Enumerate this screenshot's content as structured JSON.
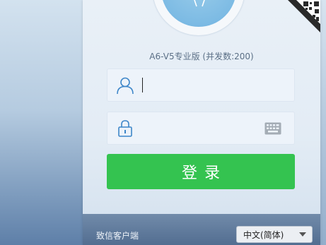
{
  "window": {
    "version_label": "A6-V5专业版 (并发数:200)"
  },
  "login_form": {
    "username": {
      "value": "",
      "placeholder": "",
      "icon": "user-icon"
    },
    "password": {
      "value": "",
      "placeholder": "",
      "icon": "lock-icon",
      "keyboard_icon": "keyboard-icon"
    },
    "login_button_label": "登录"
  },
  "footer": {
    "client_label": "致信客户端",
    "language": {
      "selected": "中文(简体)",
      "icon": "chevron-down-icon"
    }
  },
  "colors": {
    "primary_button": "#34c350",
    "avatar": "#7dbbe4"
  }
}
